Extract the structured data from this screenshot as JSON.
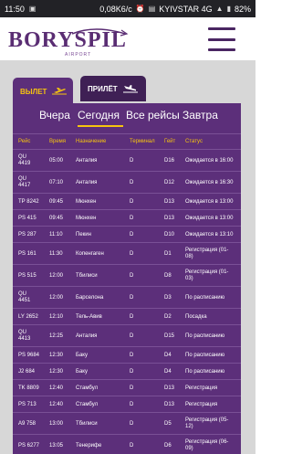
{
  "statusbar": {
    "time": "11:50",
    "speed": "0,08K6/c",
    "carrier": "KYIVSTAR 4G",
    "battery": "82%"
  },
  "header": {
    "logo_text": "BORYSPIL",
    "logo_sub": "AIRPORT"
  },
  "tabs": {
    "departures": "ВЫЛЕТ",
    "arrivals": "ПРИЛЁТ"
  },
  "day_tabs": [
    "Вчера",
    "Сегодня",
    "Все рейсы",
    "Завтра"
  ],
  "table": {
    "headers": [
      "Рейс",
      "Время",
      "Назначение",
      "Терминал",
      "Гейт",
      "Статус"
    ],
    "rows": [
      {
        "flight": [
          "QU",
          "4419"
        ],
        "time": "05:00",
        "dest": "Анталия",
        "terminal": "D",
        "gate": "D16",
        "status": [
          "Ожидается в 16:00"
        ]
      },
      {
        "flight": [
          "QU",
          "4417"
        ],
        "time": "07:10",
        "dest": "Анталия",
        "terminal": "D",
        "gate": "D12",
        "status": [
          "Ожидается в 16:30"
        ]
      },
      {
        "flight": [
          "TP 8242"
        ],
        "time": "09:45",
        "dest": "Мюнхен",
        "terminal": "D",
        "gate": "D13",
        "status": [
          "Ожидается в 13:00"
        ]
      },
      {
        "flight": [
          "PS 415"
        ],
        "time": "09:45",
        "dest": "Мюнхен",
        "terminal": "D",
        "gate": "D13",
        "status": [
          "Ожидается в 13:00"
        ]
      },
      {
        "flight": [
          "PS 287"
        ],
        "time": "11:10",
        "dest": "Пекин",
        "terminal": "D",
        "gate": "D10",
        "status": [
          "Ожидается в 13:10"
        ]
      },
      {
        "flight": [
          "PS 161"
        ],
        "time": "11:30",
        "dest": "Копенгаген",
        "terminal": "D",
        "gate": "D1",
        "status": [
          "Регистрация (01-",
          "08)"
        ]
      },
      {
        "flight": [
          "PS 515"
        ],
        "time": "12:00",
        "dest": "Тбилиси",
        "terminal": "D",
        "gate": "D8",
        "status": [
          "Регистрация (01-",
          "03)"
        ]
      },
      {
        "flight": [
          "QU",
          "4451"
        ],
        "time": "12:00",
        "dest": "Барселона",
        "terminal": "D",
        "gate": "D3",
        "status": [
          "По расписанию"
        ]
      },
      {
        "flight": [
          "LY 2652"
        ],
        "time": "12:10",
        "dest": "Тель-Авив",
        "terminal": "D",
        "gate": "D2",
        "status": [
          "Посадка"
        ]
      },
      {
        "flight": [
          "QU",
          "4413"
        ],
        "time": "12:25",
        "dest": "Анталия",
        "terminal": "D",
        "gate": "D15",
        "status": [
          "По расписанию"
        ]
      },
      {
        "flight": [
          "PS 9684"
        ],
        "time": "12:30",
        "dest": "Баку",
        "terminal": "D",
        "gate": "D4",
        "status": [
          "По расписанию"
        ]
      },
      {
        "flight": [
          "J2 684"
        ],
        "time": "12:30",
        "dest": "Баку",
        "terminal": "D",
        "gate": "D4",
        "status": [
          "По расписанию"
        ]
      },
      {
        "flight": [
          "TK 8809"
        ],
        "time": "12:40",
        "dest": "Стамбул",
        "terminal": "D",
        "gate": "D13",
        "status": [
          "Регистрация"
        ]
      },
      {
        "flight": [
          "PS 713"
        ],
        "time": "12:40",
        "dest": "Стамбул",
        "terminal": "D",
        "gate": "D13",
        "status": [
          "Регистрация"
        ]
      },
      {
        "flight": [
          "A9 758"
        ],
        "time": "13:00",
        "dest": "Тбилиси",
        "terminal": "D",
        "gate": "D5",
        "status": [
          "Регистрация (05-",
          "12)"
        ]
      },
      {
        "flight": [
          "PS 6277"
        ],
        "time": "13:05",
        "dest": "Тенерифе",
        "terminal": "D",
        "gate": "D6",
        "status": [
          "Регистрация (06-",
          "09)"
        ]
      }
    ]
  },
  "colors": {
    "panel": "#5c2f7a",
    "accent": "#f6c40f",
    "brand": "#5a2d73"
  }
}
